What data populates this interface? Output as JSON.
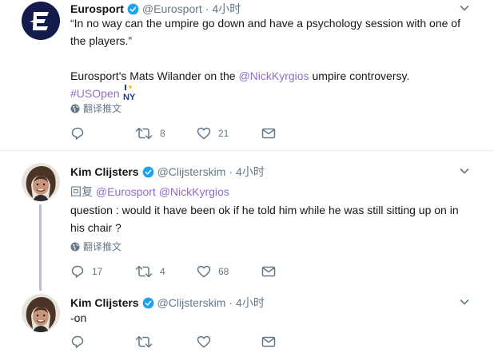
{
  "tweets": [
    {
      "display_name": "Eurosport",
      "handle": "@Eurosport",
      "separator": "·",
      "time": "4小时",
      "text_line1": "“In no way can the umpire go down and have a psychology session with one of",
      "text_line2": "the players.”",
      "text_line3_prefix": "Eurosport's Mats Wilander on the ",
      "text_line3_mention": "@NickKyrgios",
      "text_line3_suffix": " umpire controversy.",
      "hashtag": "#USOpen",
      "translate_label": "翻译推文",
      "reply_count": "",
      "retweet_count": "8",
      "like_count": "21"
    },
    {
      "display_name": "Kim Clijsters",
      "handle": "@Clijsterskim",
      "separator": "·",
      "time": "4小时",
      "reply_prefix": "回复 ",
      "reply_mentions": "@Eurosport @NickKyrgios",
      "text_line1": "question : would it have been ok if he told him while he was still sitting up on in",
      "text_line2": "his chair ?",
      "translate_label": "翻译推文",
      "reply_count": "17",
      "retweet_count": "4",
      "like_count": "68"
    },
    {
      "display_name": "Kim Clijsters",
      "handle": "@Clijsterskim",
      "separator": "·",
      "time": "4小时",
      "text_line1": "-on",
      "reply_count": "",
      "retweet_count": "",
      "like_count": ""
    }
  ],
  "colors": {
    "link": "#8e6dc9",
    "verified": "#1da1f2",
    "meta": "#657786",
    "thread_line": "#c6b2ec",
    "eurosport_brand": "#141b4d"
  }
}
